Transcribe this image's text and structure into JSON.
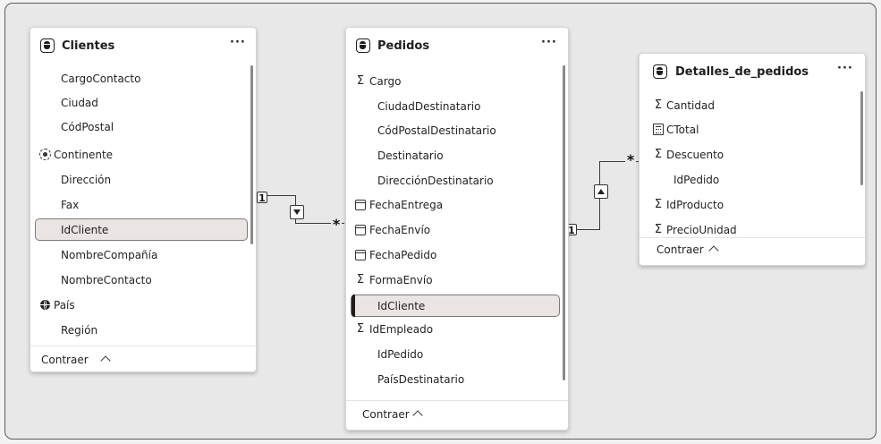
{
  "canvas": {
    "background": "#e9e8e8",
    "card_bg": "#ffffff",
    "selected_bg": "#eae4e2"
  },
  "tables": {
    "clientes": {
      "title": "Clientes",
      "more": "···",
      "fields": [
        {
          "label": "CargoContacto",
          "icon": ""
        },
        {
          "label": "Ciudad",
          "icon": ""
        },
        {
          "label": "CódPostal",
          "icon": ""
        },
        {
          "label": "Continente",
          "icon": "hierarchy-icon"
        },
        {
          "label": "Dirección",
          "icon": ""
        },
        {
          "label": "Fax",
          "icon": ""
        },
        {
          "label": "IdCliente",
          "icon": "",
          "selected": true
        },
        {
          "label": "NombreCompañía",
          "icon": ""
        },
        {
          "label": "NombreContacto",
          "icon": ""
        },
        {
          "label": "País",
          "icon": "globe-icon"
        },
        {
          "label": "Región",
          "icon": ""
        }
      ],
      "footer": "Contraer"
    },
    "pedidos": {
      "title": "Pedidos",
      "more": "···",
      "fields": [
        {
          "label": "Cargo",
          "icon": "sum-icon"
        },
        {
          "label": "CiudadDestinatario",
          "icon": ""
        },
        {
          "label": "CódPostalDestinatario",
          "icon": ""
        },
        {
          "label": "Destinatario",
          "icon": ""
        },
        {
          "label": "DirecciónDestinatario",
          "icon": ""
        },
        {
          "label": "FechaEntrega",
          "icon": "calendar-icon"
        },
        {
          "label": "FechaEnvío",
          "icon": "calendar-icon"
        },
        {
          "label": "FechaPedido",
          "icon": "calendar-icon"
        },
        {
          "label": "FormaEnvío",
          "icon": "sum-icon"
        },
        {
          "label": "IdCliente",
          "icon": "",
          "selected": true
        },
        {
          "label": "IdEmpleado",
          "icon": "sum-icon"
        },
        {
          "label": "IdPedido",
          "icon": ""
        },
        {
          "label": "PaísDestinatario",
          "icon": ""
        }
      ],
      "footer": "Contraer"
    },
    "detalles": {
      "title": "Detalles_de_pedidos",
      "more": "···",
      "fields": [
        {
          "label": "Cantidad",
          "icon": "sum-icon"
        },
        {
          "label": "CTotal",
          "icon": "calculated-column-icon"
        },
        {
          "label": "Descuento",
          "icon": "sum-icon"
        },
        {
          "label": "IdPedido",
          "icon": ""
        },
        {
          "label": "IdProducto",
          "icon": "sum-icon"
        },
        {
          "label": "PrecioUnidad",
          "icon": "sum-icon"
        }
      ],
      "footer": "Contraer"
    }
  },
  "relationships": [
    {
      "from": "Clientes",
      "to": "Pedidos",
      "from_cardinality": "1",
      "to_cardinality": "*",
      "filter_direction": "down-arrow-icon"
    },
    {
      "from": "Pedidos",
      "to": "Detalles_de_pedidos",
      "from_cardinality": "1",
      "to_cardinality": "*",
      "filter_direction": "up-arrow-icon"
    }
  ]
}
